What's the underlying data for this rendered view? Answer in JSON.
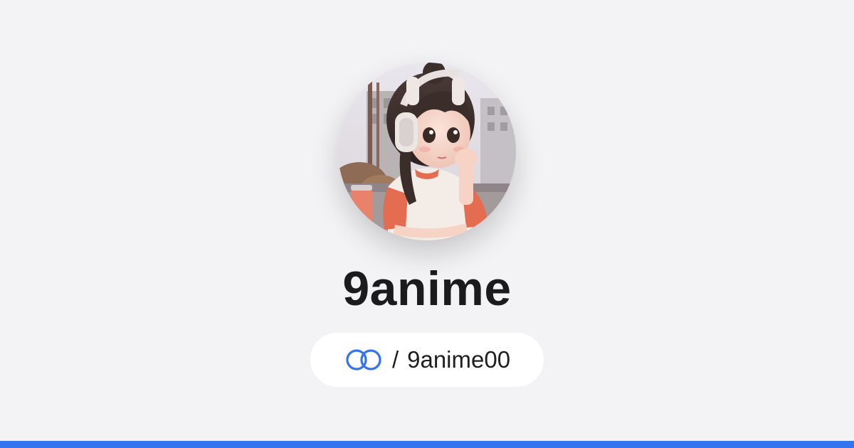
{
  "profile": {
    "display_name": "9anime",
    "handle_separator": "/",
    "handle": "9anime00",
    "avatar_icon": "avatar-illustration-girl-with-headphones",
    "link_icon": "linked-rings-icon"
  },
  "colors": {
    "background": "#f3f3f5",
    "accent": "#3574f0",
    "title": "#1b1b1b",
    "pill_background": "#ffffff"
  }
}
